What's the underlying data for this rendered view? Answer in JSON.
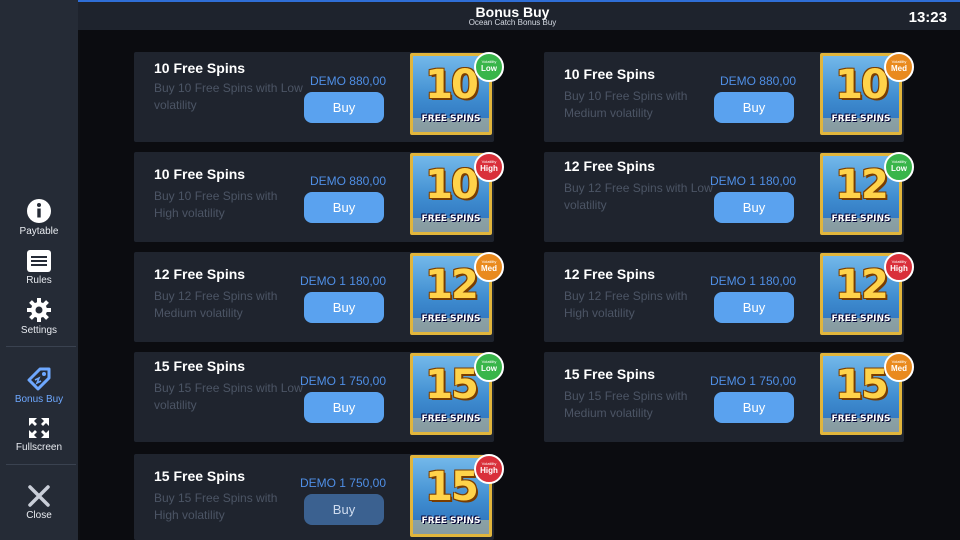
{
  "header": {
    "title": "Bonus Buy",
    "subtitle": "Ocean Catch Bonus Buy",
    "clock": "13:23"
  },
  "sidebar": {
    "paytable": "Paytable",
    "rules": "Rules",
    "settings": "Settings",
    "bonus_buy": "Bonus Buy",
    "fullscreen": "Fullscreen",
    "close": "Close"
  },
  "volatility_label": "Volatility",
  "thumb_caption": "FREE SPINS",
  "cards": [
    {
      "title": "10 Free Spins",
      "desc": "Buy 10 Free Spins with Low volatility",
      "price": "DEMO 880,00",
      "buy": "Buy",
      "spins": "10",
      "badge": "Low",
      "level": "low"
    },
    {
      "title": "10 Free Spins",
      "desc": "Buy 10 Free Spins with Medium volatility",
      "price": "DEMO 880,00",
      "buy": "Buy",
      "spins": "10",
      "badge": "Med",
      "level": "med"
    },
    {
      "title": "10 Free Spins",
      "desc": "Buy 10 Free Spins with High volatility",
      "price": "DEMO 880,00",
      "buy": "Buy",
      "spins": "10",
      "badge": "High",
      "level": "high"
    },
    {
      "title": "12 Free Spins",
      "desc": "Buy 12 Free Spins with Low volatility",
      "price": "DEMO 1 180,00",
      "buy": "Buy",
      "spins": "12",
      "badge": "Low",
      "level": "low"
    },
    {
      "title": "12 Free Spins",
      "desc": "Buy 12 Free Spins with Medium volatility",
      "price": "DEMO 1 180,00",
      "buy": "Buy",
      "spins": "12",
      "badge": "Med",
      "level": "med"
    },
    {
      "title": "12 Free Spins",
      "desc": "Buy 12 Free Spins with High volatility",
      "price": "DEMO 1 180,00",
      "buy": "Buy",
      "spins": "12",
      "badge": "High",
      "level": "high"
    },
    {
      "title": "15 Free Spins",
      "desc": "Buy 15 Free Spins with Low volatility",
      "price": "DEMO 1 750,00",
      "buy": "Buy",
      "spins": "15",
      "badge": "Low",
      "level": "low"
    },
    {
      "title": "15 Free Spins",
      "desc": "Buy 15 Free Spins with Medium volatility",
      "price": "DEMO 1 750,00",
      "buy": "Buy",
      "spins": "15",
      "badge": "Med",
      "level": "med"
    },
    {
      "title": "15 Free Spins",
      "desc": "Buy 15 Free Spins with High volatility",
      "price": "DEMO 1 750,00",
      "buy": "Buy",
      "spins": "15",
      "badge": "High",
      "level": "high"
    }
  ]
}
